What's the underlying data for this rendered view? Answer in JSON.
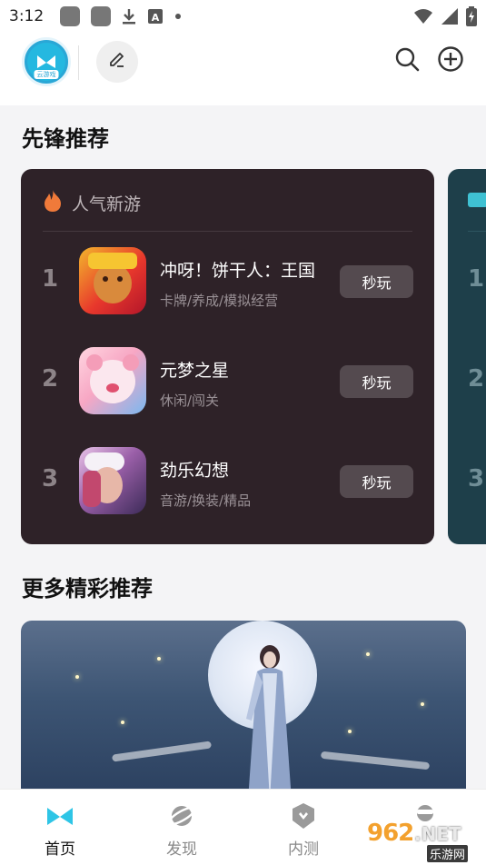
{
  "status_bar": {
    "time": "3:12",
    "icons": [
      "notification-icon",
      "notification-icon",
      "download-icon",
      "keyboard-icon",
      "dot-icon",
      "wifi-icon",
      "signal-icon",
      "battery-icon"
    ]
  },
  "header": {
    "logo_tag": "云游戏",
    "icons": [
      "edit-icon",
      "search-icon",
      "add-circle-icon"
    ]
  },
  "section_pioneer": {
    "title": "先锋推荐"
  },
  "rank_card": {
    "title": "人气新游",
    "icon": "flame-icon",
    "games": [
      {
        "rank": "1",
        "name": "冲呀！饼干人：王国",
        "tags": "卡牌/养成/模拟经营",
        "button": "秒玩"
      },
      {
        "rank": "2",
        "name": "元梦之星",
        "tags": "休闲/闯关",
        "button": "秒玩"
      },
      {
        "rank": "3",
        "name": "劲乐幻想",
        "tags": "音游/换装/精品",
        "button": "秒玩"
      }
    ]
  },
  "peek_card": {
    "icon": "thumbs-up-icon",
    "ranks": [
      "1",
      "2",
      "3"
    ]
  },
  "section_more": {
    "title": "更多精彩推荐"
  },
  "bottom_nav": {
    "items": [
      {
        "label": "首页",
        "icon": "gamepad-icon",
        "active": true
      },
      {
        "label": "发现",
        "icon": "planet-icon",
        "active": false
      },
      {
        "label": "内测",
        "icon": "shield-icon",
        "active": false
      },
      {
        "label": "",
        "icon": "profile-icon",
        "active": false
      }
    ]
  },
  "watermark": {
    "brand": "962",
    "domain": ".NET",
    "subtitle": "乐游网"
  },
  "colors": {
    "card_bg": "#2e2228",
    "peek_bg": "#1e3f4a",
    "play_button": "#544a4f",
    "accent": "#2aa7d6",
    "flame": "#f07a3a"
  }
}
